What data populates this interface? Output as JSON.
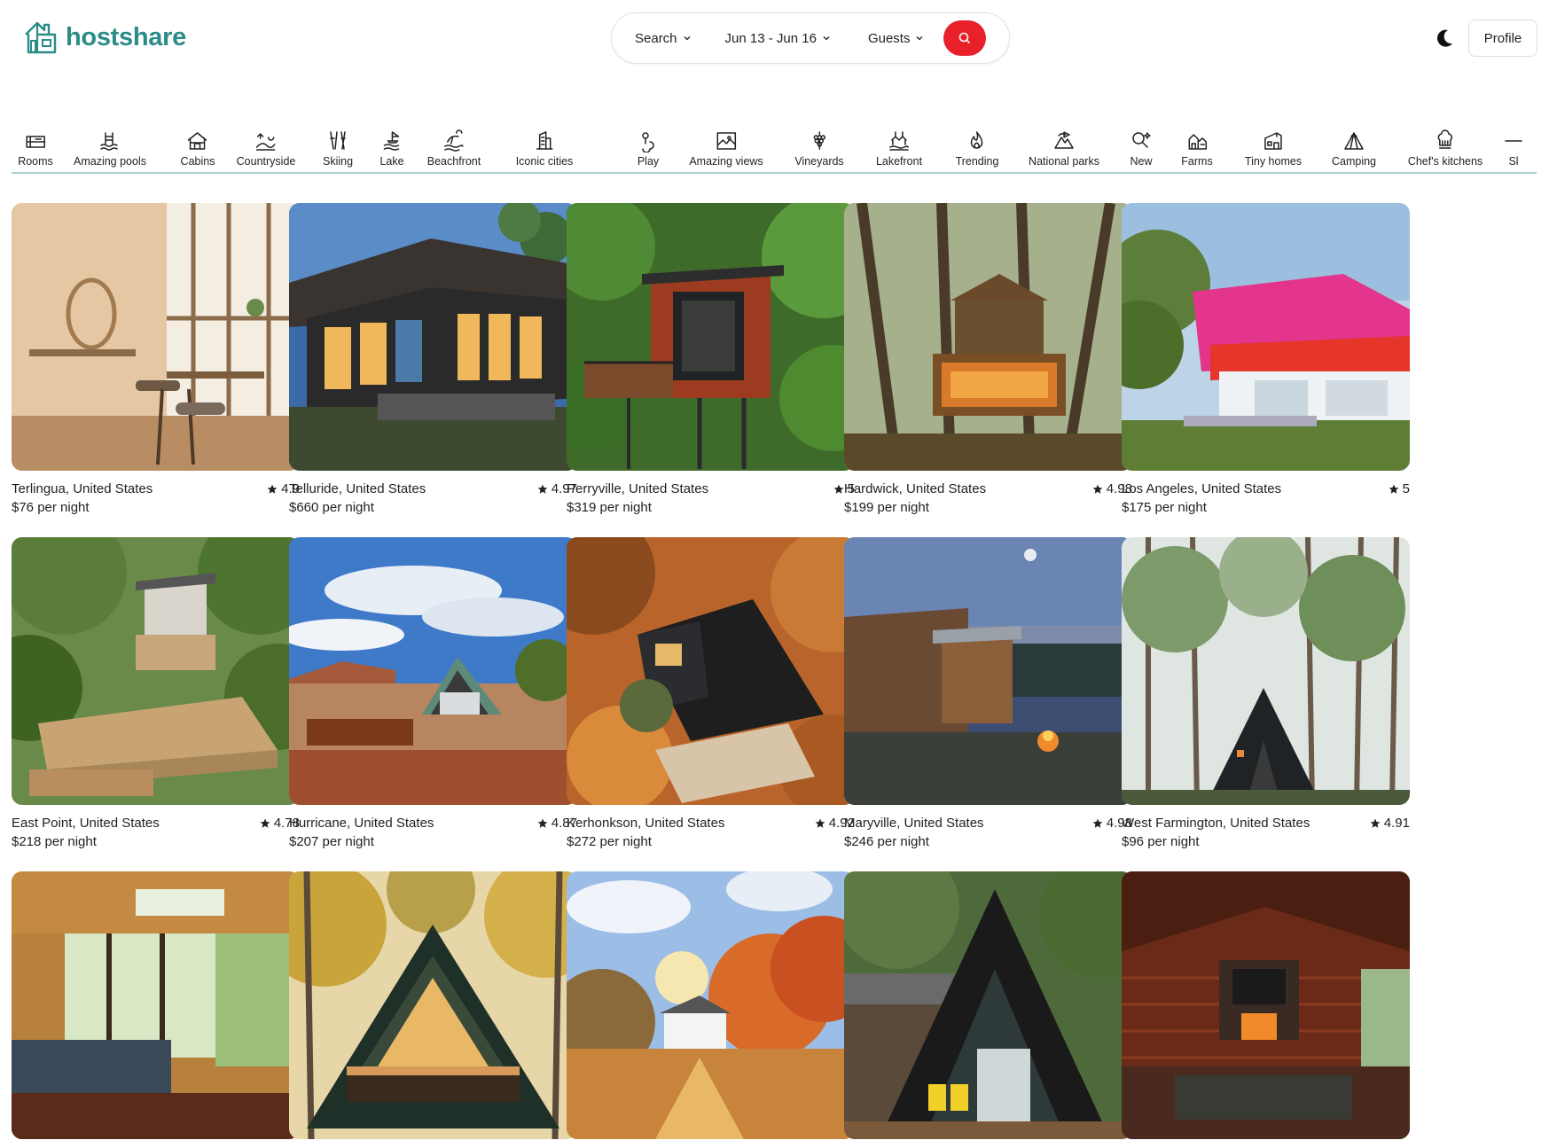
{
  "app": {
    "name": "hostshare",
    "accent": "#2b8c87",
    "search_accent": "#e8202a"
  },
  "search": {
    "where": "Search",
    "dates": "Jun 13 - Jun 16",
    "guests": "Guests"
  },
  "header": {
    "profile_label": "Profile",
    "theme_icon": "moon-icon"
  },
  "categories": [
    {
      "label": "Rooms",
      "icon": "rooms-icon"
    },
    {
      "label": "Amazing pools",
      "icon": "pool-icon"
    },
    {
      "label": "Cabins",
      "icon": "cabin-icon"
    },
    {
      "label": "Countryside",
      "icon": "countryside-icon"
    },
    {
      "label": "Skiing",
      "icon": "skiing-icon"
    },
    {
      "label": "Lake",
      "icon": "lake-icon"
    },
    {
      "label": "Beachfront",
      "icon": "beach-icon"
    },
    {
      "label": "Iconic cities",
      "icon": "city-icon"
    },
    {
      "label": "Play",
      "icon": "play-icon"
    },
    {
      "label": "Amazing views",
      "icon": "views-icon"
    },
    {
      "label": "Vineyards",
      "icon": "vineyard-icon"
    },
    {
      "label": "Lakefront",
      "icon": "lakefront-icon"
    },
    {
      "label": "Trending",
      "icon": "fire-icon"
    },
    {
      "label": "National parks",
      "icon": "park-icon"
    },
    {
      "label": "New",
      "icon": "new-icon"
    },
    {
      "label": "Farms",
      "icon": "farm-icon"
    },
    {
      "label": "Tiny homes",
      "icon": "tiny-home-icon"
    },
    {
      "label": "Camping",
      "icon": "camping-icon"
    },
    {
      "label": "Chef's kitchens",
      "icon": "chef-icon"
    },
    {
      "label": "Sl",
      "icon": "more-icon"
    }
  ],
  "listings": [
    {
      "location": "Terlingua, United States",
      "rating": "4.9",
      "price": "$76 per night"
    },
    {
      "location": "Telluride, United States",
      "rating": "4.97",
      "price": "$660 per night"
    },
    {
      "location": "Perryville, United States",
      "rating": "5",
      "price": "$319 per night"
    },
    {
      "location": "Hardwick, United States",
      "rating": "4.98",
      "price": "$199 per night"
    },
    {
      "location": "Los Angeles, United States",
      "rating": "5",
      "price": "$175 per night"
    },
    {
      "location": "East Point, United States",
      "rating": "4.78",
      "price": "$218 per night"
    },
    {
      "location": "Hurricane, United States",
      "rating": "4.87",
      "price": "$207 per night"
    },
    {
      "location": "Kerhonkson, United States",
      "rating": "4.92",
      "price": "$272 per night"
    },
    {
      "location": "Maryville, United States",
      "rating": "4.98",
      "price": "$246 per night"
    },
    {
      "location": "West Farmington, United States",
      "rating": "4.91",
      "price": "$96 per night"
    },
    {
      "location": "",
      "rating": "",
      "price": ""
    },
    {
      "location": "",
      "rating": "",
      "price": ""
    },
    {
      "location": "",
      "rating": "",
      "price": ""
    },
    {
      "location": "",
      "rating": "",
      "price": ""
    },
    {
      "location": "",
      "rating": "",
      "price": ""
    }
  ]
}
